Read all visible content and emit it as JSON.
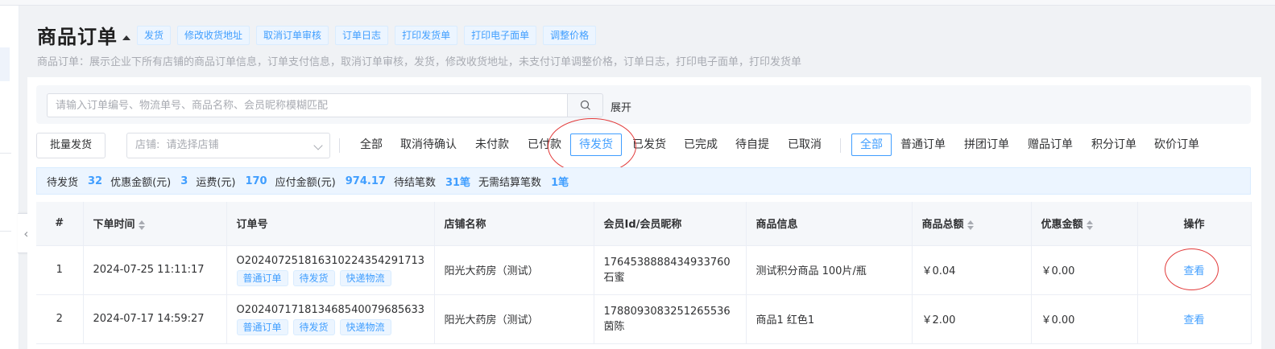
{
  "header": {
    "title": "商品订单",
    "actions": [
      "发货",
      "修改收货地址",
      "取消订单审核",
      "订单日志",
      "打印发货单",
      "打印电子面单",
      "调整价格"
    ],
    "description": "商品订单：展示企业下所有店铺的商品订单信息，订单支付信息，取消订单审核，发货，修改收货地址，未支付订单调整价格，订单日志，打印电子面单，打印发货单"
  },
  "search": {
    "placeholder": "请输入订单编号、物流单号、商品名称、会员昵称模糊匹配",
    "expand_label": "展开"
  },
  "toolbar": {
    "batch_ship_label": "批量发货",
    "store_select_label": "店铺:",
    "store_select_placeholder": "请选择店铺"
  },
  "status_filters": [
    "全部",
    "取消待确认",
    "未付款",
    "已付款",
    "待发货",
    "已发货",
    "已完成",
    "待自提",
    "已取消"
  ],
  "status_filter_selected": "待发货",
  "type_filters": [
    "全部",
    "普通订单",
    "拼团订单",
    "赠品订单",
    "积分订单",
    "砍价订单"
  ],
  "type_filter_selected": "全部",
  "summary": [
    {
      "label": "待发货",
      "value": "32"
    },
    {
      "label": "优惠金额(元)",
      "value": "3"
    },
    {
      "label": "运费(元)",
      "value": "170"
    },
    {
      "label": "应付金额(元)",
      "value": "974.17"
    },
    {
      "label": "待结笔数",
      "value": "31笔"
    },
    {
      "label": "无需结算笔数",
      "value": "1笔"
    }
  ],
  "table": {
    "columns": [
      "#",
      "下单时间",
      "订单号",
      "店铺名称",
      "会员Id/会员昵称",
      "商品信息",
      "商品总额",
      "优惠金额",
      "操作"
    ],
    "rows": [
      {
        "index": "1",
        "time": "2024-07-25 11:11:17",
        "order_no": "O202407251816310224354291713",
        "tags": [
          "普通订单",
          "待发货",
          "快递物流"
        ],
        "store": "阳光大药房（测试）",
        "member_id": "1764538888434933760",
        "member_name": "石蜜",
        "goods": "测试积分商品 100片/瓶",
        "total": "￥0.04",
        "discount": "￥0.00",
        "action": "查看"
      },
      {
        "index": "2",
        "time": "2024-07-17 14:59:27",
        "order_no": "O202407171813468540079685633",
        "tags": [
          "普通订单",
          "待发货",
          "快递物流"
        ],
        "store": "阳光大药房（测试）",
        "member_id": "1788093083251265536",
        "member_name": "茵陈",
        "goods": "商品1 红色1",
        "total": "￥2.00",
        "discount": "￥0.00",
        "action": "查看"
      }
    ]
  },
  "colors": {
    "accent": "#409eff",
    "annotation": "#e23a3a"
  }
}
